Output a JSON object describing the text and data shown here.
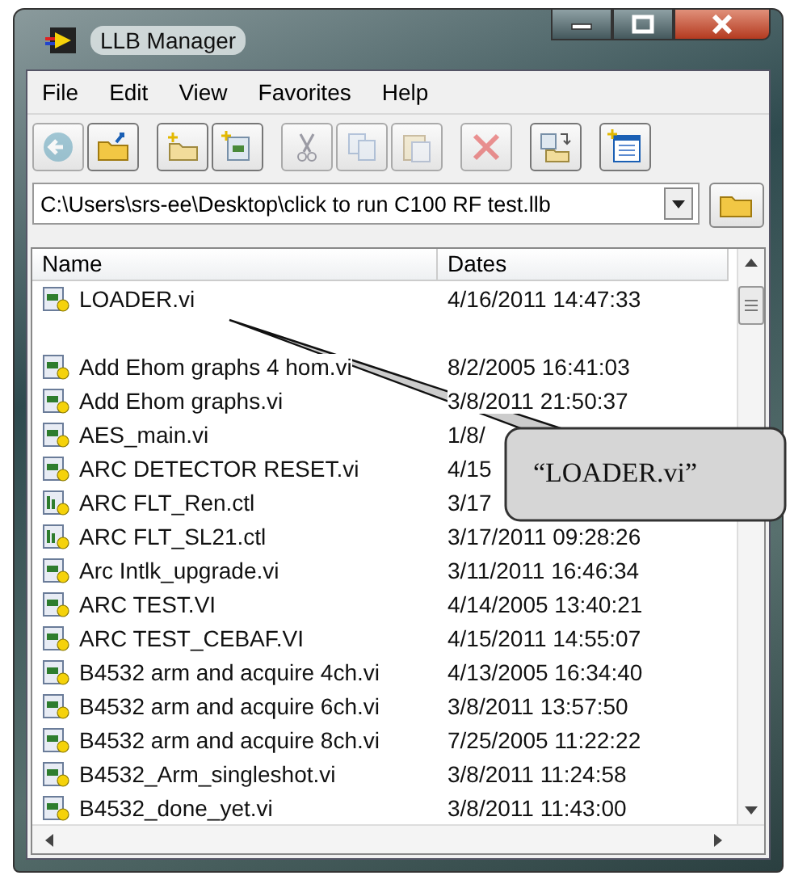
{
  "window": {
    "title": "LLB Manager"
  },
  "menu": [
    "File",
    "Edit",
    "View",
    "Favorites",
    "Help"
  ],
  "toolbar": [
    {
      "kind": "back",
      "disabled": true
    },
    {
      "kind": "open",
      "disabled": false
    },
    {
      "kind": "new-folder",
      "disabled": false
    },
    {
      "kind": "new-file",
      "disabled": false
    },
    {
      "kind": "cut",
      "disabled": true
    },
    {
      "kind": "copy",
      "disabled": true
    },
    {
      "kind": "paste",
      "disabled": true
    },
    {
      "kind": "delete",
      "disabled": true
    },
    {
      "kind": "move",
      "disabled": false
    },
    {
      "kind": "properties",
      "disabled": false
    }
  ],
  "path": {
    "value": "C:\\Users\\srs-ee\\Desktop\\click to run C100 RF test.llb"
  },
  "table": {
    "columns": [
      "Name",
      "Dates"
    ],
    "rows": [
      {
        "kind": "vi",
        "name": "LOADER.vi",
        "date": "4/16/2011 14:47:33"
      },
      {
        "kind": "blank"
      },
      {
        "kind": "vi",
        "name": "Add Ehom graphs 4 hom.vi",
        "date": "8/2/2005 16:41:03"
      },
      {
        "kind": "vi",
        "name": "Add Ehom graphs.vi",
        "date": "3/8/2011 21:50:37"
      },
      {
        "kind": "vi",
        "name": "AES_main.vi",
        "date": "1/8/"
      },
      {
        "kind": "vi",
        "name": "ARC DETECTOR RESET.vi",
        "date": "4/15"
      },
      {
        "kind": "ctl",
        "name": "ARC FLT_Ren.ctl",
        "date": "3/17"
      },
      {
        "kind": "ctl",
        "name": "ARC FLT_SL21.ctl",
        "date": "3/17/2011 09:28:26"
      },
      {
        "kind": "vi",
        "name": "Arc Intlk_upgrade.vi",
        "date": "3/11/2011 16:46:34"
      },
      {
        "kind": "vi",
        "name": "ARC TEST.VI",
        "date": "4/14/2005 13:40:21"
      },
      {
        "kind": "vi",
        "name": "ARC TEST_CEBAF.VI",
        "date": "4/15/2011 14:55:07"
      },
      {
        "kind": "vi",
        "name": "B4532 arm and acquire 4ch.vi",
        "date": "4/13/2005 16:34:40"
      },
      {
        "kind": "vi",
        "name": "B4532 arm and acquire 6ch.vi",
        "date": "3/8/2011 13:57:50"
      },
      {
        "kind": "vi",
        "name": "B4532 arm and acquire 8ch.vi",
        "date": "7/25/2005 11:22:22"
      },
      {
        "kind": "vi",
        "name": "B4532_Arm_singleshot.vi",
        "date": "3/8/2011 11:24:58"
      },
      {
        "kind": "vi",
        "name": "B4532_done_yet.vi",
        "date": "3/8/2011 11:43:00"
      }
    ]
  },
  "callout": {
    "text": "“LOADER.vi”"
  }
}
